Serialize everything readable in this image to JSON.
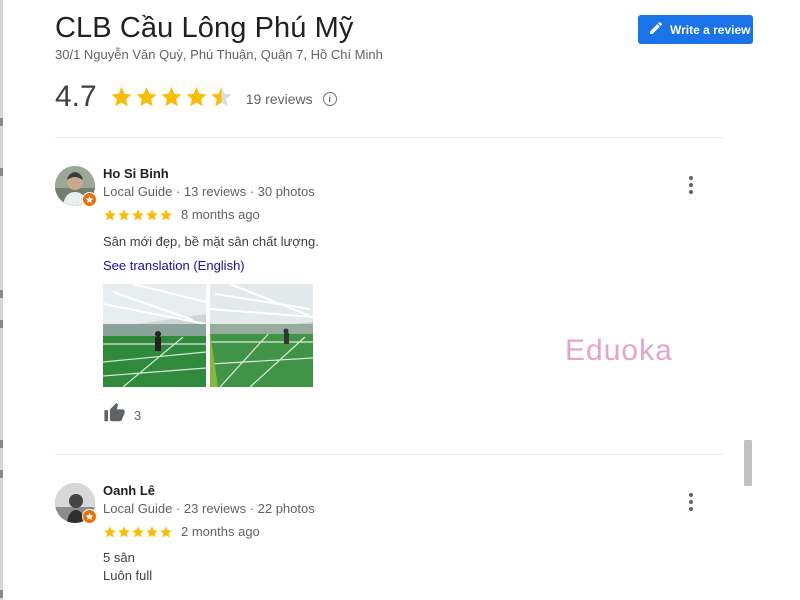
{
  "place": {
    "name": "CLB Cầu Lông Phú Mỹ",
    "address": "30/1 Nguyễn Văn Quỳ, Phú Thuận, Quận 7, Hồ Chí Minh",
    "rating": "4.7",
    "rating_value": 4.7,
    "review_count": "19 reviews"
  },
  "actions": {
    "write_review_label": "Write a review"
  },
  "reviews": [
    {
      "name": "Ho Si Binh",
      "meta": "Local Guide · 13 reviews · 30 photos",
      "stars": 5,
      "time": "8 months ago",
      "text_lines": [
        "Sân mới đẹp, bề mặt sân chất lượng."
      ],
      "translate_label": "See translation (English)",
      "likes": "3"
    },
    {
      "name": "Oanh Lê",
      "meta": "Local Guide · 23 reviews · 22 photos",
      "stars": 5,
      "time": "2 months ago",
      "text_lines": [
        "5 sân",
        "Luôn full"
      ]
    }
  ],
  "watermark": "Eduoka",
  "colors": {
    "star": "#fbbc04",
    "accent": "#1a73e8",
    "link": "#1a0dab",
    "guide_badge": "#e8710a",
    "watermark": "#e5a3cf"
  },
  "icons": [
    "pencil-icon",
    "info-icon",
    "more-vert-icon",
    "thumb-up-icon",
    "local-guide-badge-icon"
  ]
}
